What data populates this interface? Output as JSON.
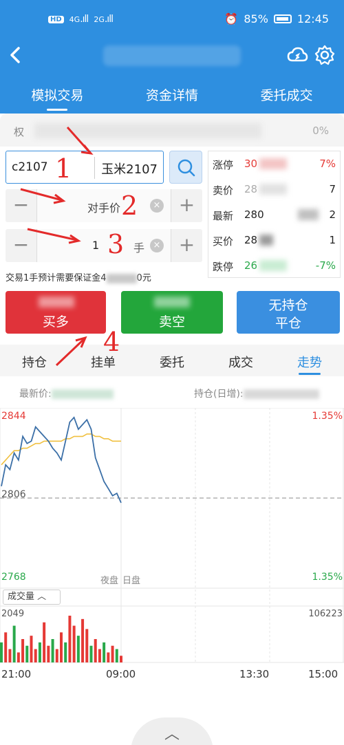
{
  "status_bar": {
    "hd": "HD",
    "net1": "4G",
    "net2": "2G",
    "battery": "85%",
    "time": "12:45"
  },
  "tabs": [
    {
      "label": "模拟交易",
      "active": true
    },
    {
      "label": "资金详情",
      "active": false
    },
    {
      "label": "委托成交",
      "active": false
    }
  ],
  "account": {
    "label": "权",
    "value": "0%"
  },
  "order": {
    "code": "c2107",
    "name": "玉米2107",
    "price_type": "对手价",
    "quantity": "1",
    "unit": "手",
    "margin_prefix": "交易1手预计需要保证金4",
    "margin_suffix": "0元"
  },
  "quote": {
    "limit_up": {
      "label": "涨停",
      "price": "30",
      "right": "7%"
    },
    "ask": {
      "label": "卖价",
      "price": "28",
      "right": "7"
    },
    "last": {
      "label": "最新",
      "price": "280",
      "right": "2"
    },
    "bid": {
      "label": "买价",
      "price": "28",
      "right": "1"
    },
    "limit_down": {
      "label": "跌停",
      "price": "26",
      "right": "-7%"
    }
  },
  "buttons": {
    "buy": "买多",
    "sell": "卖空",
    "close_line1": "无持仓",
    "close_line2": "平仓"
  },
  "sub_tabs": [
    {
      "label": "持仓",
      "active": false
    },
    {
      "label": "挂单",
      "active": false
    },
    {
      "label": "委托",
      "active": false
    },
    {
      "label": "成交",
      "active": false
    },
    {
      "label": "走势",
      "active": true
    }
  ],
  "chart_info": {
    "last_label": "最新价:",
    "oi_label": "持仓(日增):"
  },
  "annotations": [
    "1",
    "2",
    "3",
    "4"
  ],
  "chart_data": {
    "type": "line",
    "y_top": "2844",
    "y_mid": "2806",
    "y_bottom": "2768",
    "pct_top": "1.35%",
    "pct_bottom": "1.35%",
    "session_night": "夜盘",
    "session_day": "日盘",
    "volume_toggle": "成交量",
    "vol_left": "2049",
    "vol_right": "106223",
    "x_labels": [
      "21:00",
      "09:00",
      "13:30",
      "15:00"
    ],
    "colors": {
      "price": "#3b6fa7",
      "average": "#f0c040",
      "up": "#e53935",
      "down": "#29a84a"
    },
    "price_series": [
      2811,
      2820,
      2818,
      2825,
      2822,
      2832,
      2829,
      2830,
      2836,
      2834,
      2832,
      2830,
      2827,
      2825,
      2822,
      2830,
      2838,
      2840,
      2835,
      2837,
      2839,
      2835,
      2823,
      2818,
      2813,
      2810,
      2807,
      2808,
      2804
    ],
    "avg_series": [
      2820,
      2822,
      2824,
      2826,
      2826,
      2827,
      2827,
      2828,
      2829,
      2829,
      2830,
      2830,
      2830,
      2830,
      2830,
      2831,
      2831,
      2832,
      2832,
      2832,
      2833,
      2833,
      2832,
      2832,
      2831,
      2831,
      2830,
      2830,
      2830
    ],
    "volume": [
      30,
      45,
      20,
      55,
      15,
      35,
      25,
      40,
      20,
      30,
      60,
      25,
      35,
      20,
      45,
      30,
      70,
      55,
      40,
      65,
      50,
      25,
      35,
      20,
      30,
      15,
      25,
      20,
      10
    ]
  }
}
